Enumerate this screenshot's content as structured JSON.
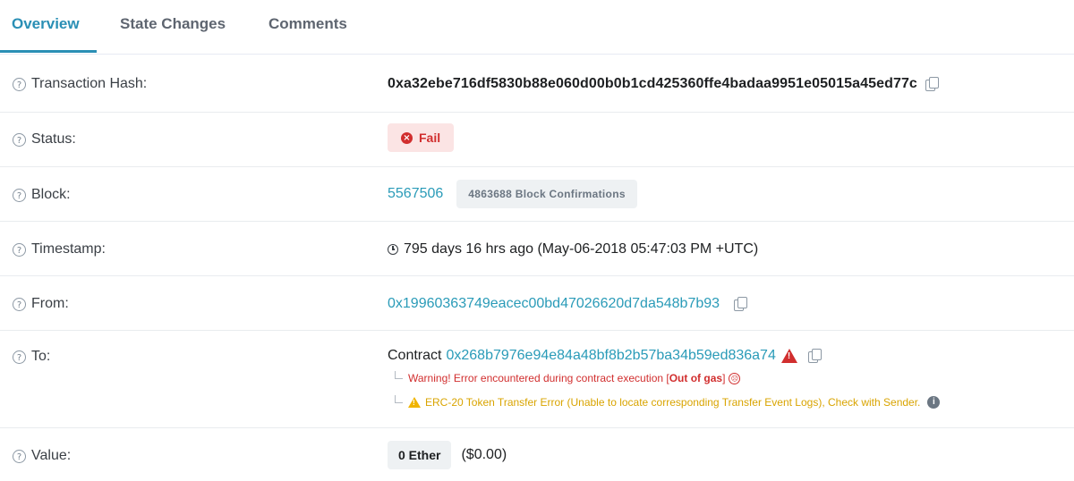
{
  "tabs": [
    "Overview",
    "State Changes",
    "Comments"
  ],
  "rows": {
    "hash": {
      "label": "Transaction Hash:",
      "value": "0xa32ebe716df5830b88e060d00b0b1cd425360ffe4badaa9951e05015a45ed77c"
    },
    "status": {
      "label": "Status:",
      "value": "Fail"
    },
    "block": {
      "label": "Block:",
      "number": "5567506",
      "confirmations": "4863688 Block Confirmations"
    },
    "timestamp": {
      "label": "Timestamp:",
      "value": "795 days 16 hrs ago (May-06-2018 05:47:03 PM +UTC)"
    },
    "from": {
      "label": "From:",
      "address": "0x19960363749eacec00bd47026620d7da548b7b93"
    },
    "to": {
      "label": "To:",
      "prefix": "Contract",
      "address": "0x268b7976e94e84a48bf8b2b57ba34b59ed836a74",
      "warning_text": "Warning! Error encountered during contract execution [",
      "warning_bold": "Out of gas",
      "warning_close": "]",
      "erc20_text": "ERC-20 Token Transfer Error (Unable to locate corresponding Transfer Event Logs), Check with Sender."
    },
    "value": {
      "label": "Value:",
      "ether": "0 Ether",
      "usd": "($0.00)"
    }
  },
  "icons": {
    "help": "?",
    "fail": "×",
    "alert": "!",
    "info": "i",
    "sad": "☹"
  },
  "colors": {
    "accent": "#2a8fb5",
    "link": "#2a9bb8",
    "fail": "#d12e2e",
    "warning": "#d9a400"
  }
}
